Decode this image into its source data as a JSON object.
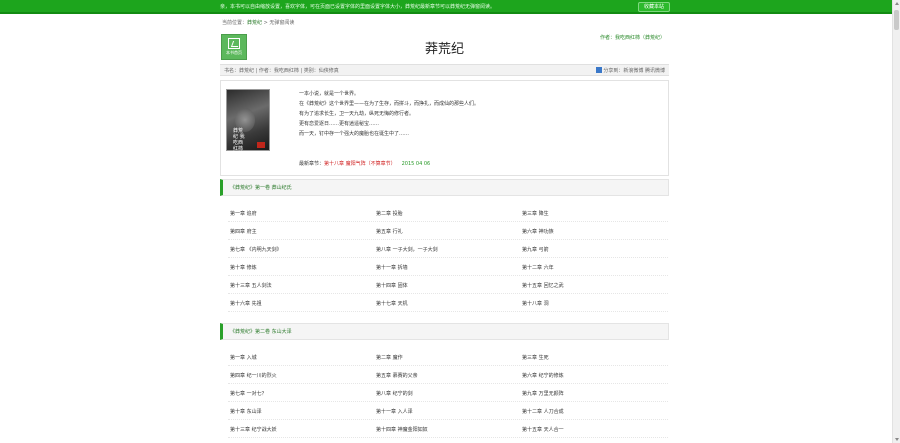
{
  "topbar": {
    "note": "亲，本书可以自由缩放设置，喜欢字体，可在页面已设置字体的里面设置字体大小，莽荒纪最新章节可以莽荒纪无弹窗阅读。",
    "bookmark_label": "收藏本站"
  },
  "breadcrumb": {
    "prefix": "当前位置：",
    "book": "莽荒纪",
    "sep": " > ",
    "current": "无弹窗阅读"
  },
  "home_button": {
    "label": "本书首页"
  },
  "book": {
    "title": "莽荒纪",
    "author_top": "作者：我吃西红柿（莽荒纪）"
  },
  "infobar": {
    "left": "书名：莽荒纪    |    作者：我吃西红柿    |    类别：仙侠修真",
    "right": "分享到：新浪微博  腾讯微博"
  },
  "intro": {
    "cover_text": "莽荒纪 我吃西红柿",
    "lines": [
      "一本小说，就是一个世界。",
      "在《莽荒纪》这个世界里——在为了生存，而拼斗，而挣扎，而成仙的那些人们。",
      "有为了追求长生，卫一天九劫，纵死无悔的修行者。",
      "更有恋爱逐日……更有逍遥秘宝……",
      "而一天，钉中存一个强大的魔胎也在诞生中了……"
    ],
    "latest_label": "最新章节：",
    "latest_chapter": "第十八章 魔阳气阵（不算章节）",
    "latest_date": "2015 04 06"
  },
  "volumes": [
    {
      "title": "《莽荒纪》第一卷 莽山纪氏",
      "chapters": [
        [
          "第一章 追府",
          "第二章 投胎",
          "第三章 降生"
        ],
        [
          "第四章 府主",
          "第五章 行礼",
          "第六章 神功族"
        ],
        [
          "第七章 《内明九天剑》",
          "第八章 一子大剑，一子大剑",
          "第九章 弓箭"
        ],
        [
          "第十章 修炼",
          "第十一章 拆墙",
          "第十二章 六年"
        ],
        [
          "第十三章 五人剑法",
          "第十四章 固体",
          "第十五章 回忆之武"
        ],
        [
          "第十六章 先祖",
          "第十七章 天机",
          "第十八章 洞"
        ]
      ]
    },
    {
      "title": "《莽荒纪》第二卷 东山大泽",
      "chapters": [
        [
          "第一章 入城",
          "第二章 魔作",
          "第三章 生死"
        ],
        [
          "第四章 纪一川的烈火",
          "第五章 慕赛的父亲",
          "第六章 纪宁的修炼"
        ],
        [
          "第七章 一对七？",
          "第八章 纪宁的剑",
          "第九章 万里无颜阵"
        ],
        [
          "第十章 东山泽",
          "第十一章 入人泽",
          "第十二章 人刀合成"
        ],
        [
          "第十三章 纪宁战大妖",
          "第十四章 神魔金阳如奴",
          "第十五章 天人合一"
        ]
      ]
    }
  ]
}
